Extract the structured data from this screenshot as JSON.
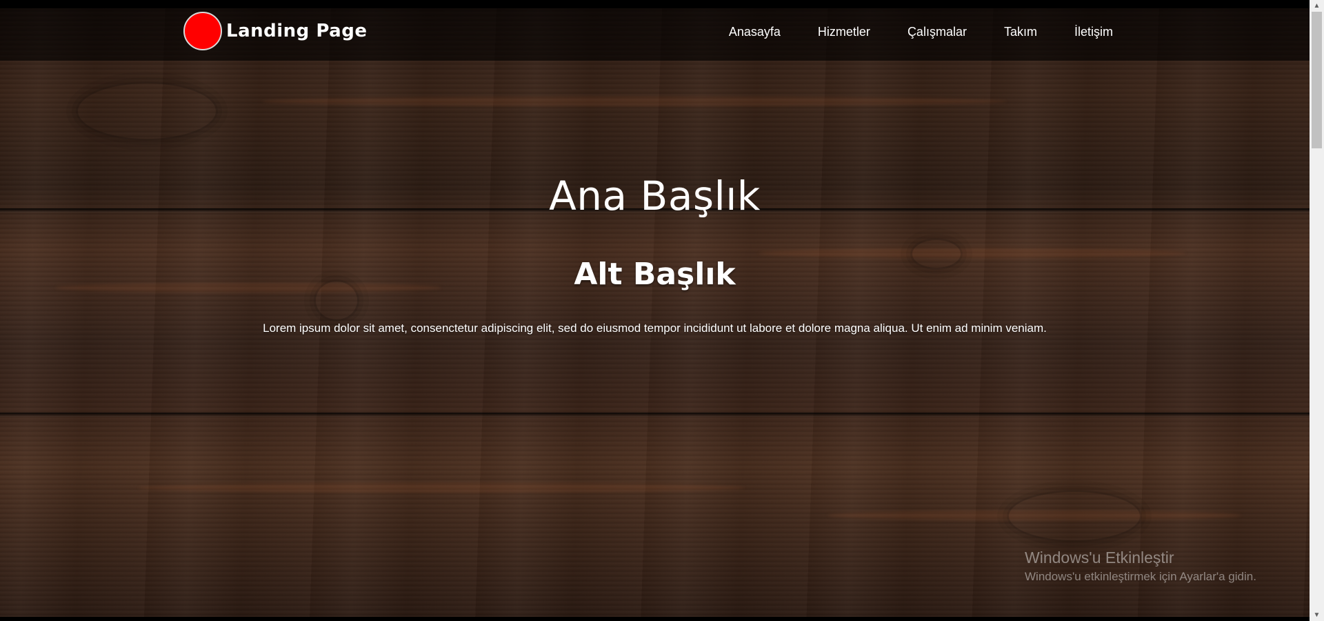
{
  "navbar": {
    "brand_name": "Landing Page",
    "brand_logo_color": "#ff0000",
    "links": [
      {
        "label": "Anasayfa"
      },
      {
        "label": "Hizmetler"
      },
      {
        "label": "Çalışmalar"
      },
      {
        "label": "Takım"
      },
      {
        "label": "İletişim"
      }
    ]
  },
  "hero": {
    "title": "Ana Başlık",
    "subtitle": "Alt Başlık",
    "text": "Lorem ipsum dolor sit amet, consenctetur adipiscing elit, sed do eiusmod tempor incididunt ut labore et dolore magna aliqua. Ut enim ad minim veniam."
  },
  "watermark": {
    "title": "Windows'u Etkinleştir",
    "text": "Windows'u etkinleştirmek için Ayarlar'a gidin."
  },
  "colors": {
    "navbar_bg": "rgba(0,0,0,0.6)",
    "text": "#ffffff",
    "wood_dark": "#2b1a13"
  }
}
